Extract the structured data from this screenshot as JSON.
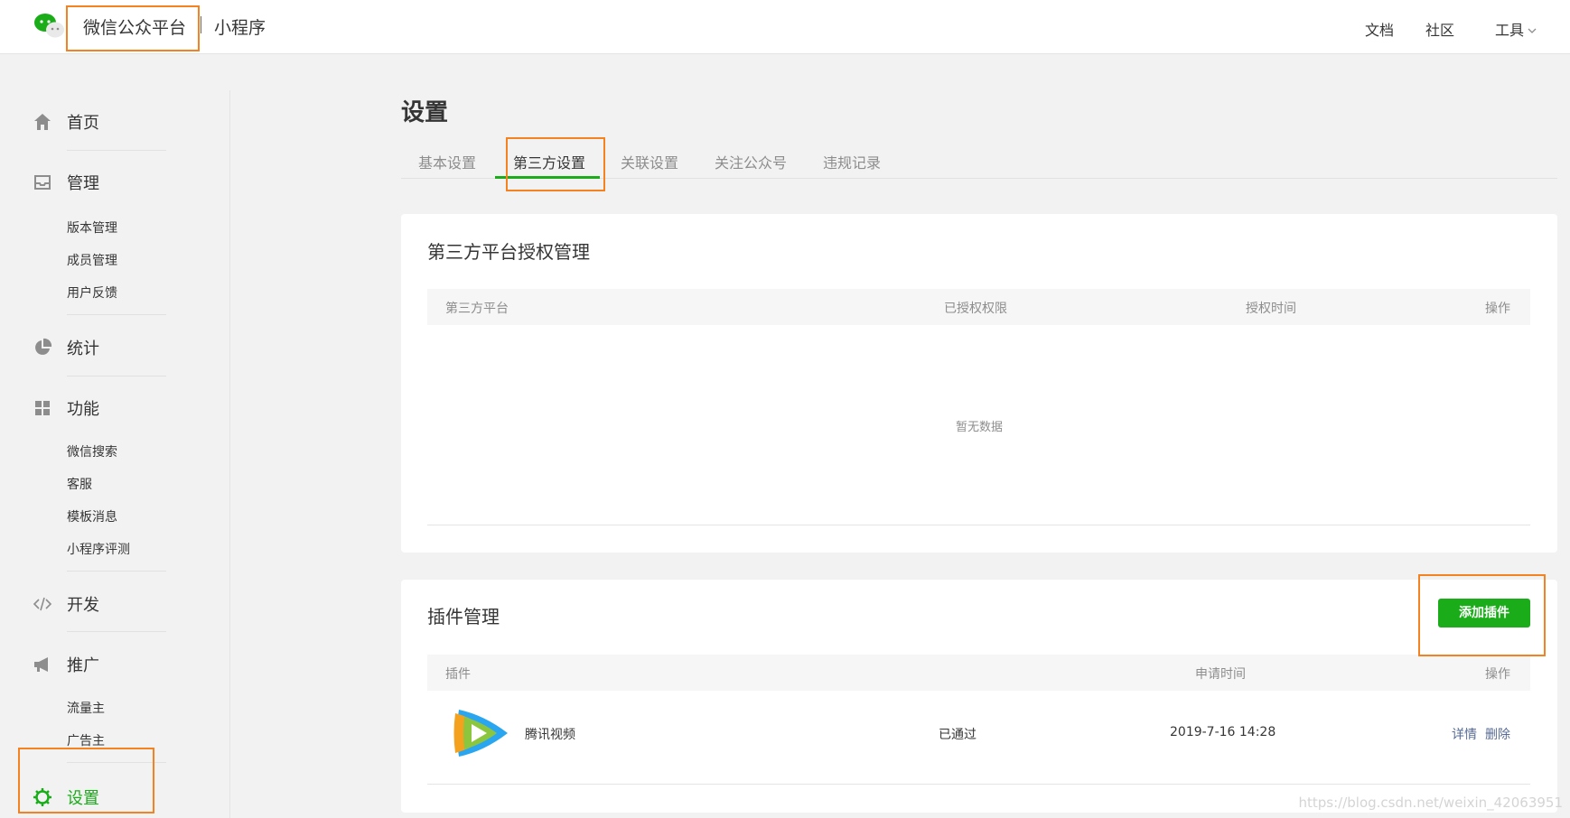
{
  "header": {
    "brand": "微信公众平台",
    "product": "小程序",
    "nav": [
      "文档",
      "社区",
      "工具"
    ]
  },
  "sidebar": {
    "home": "首页",
    "manage": {
      "label": "管理",
      "items": [
        "版本管理",
        "成员管理",
        "用户反馈"
      ]
    },
    "stats": "统计",
    "features": {
      "label": "功能",
      "items": [
        "微信搜索",
        "客服",
        "模板消息",
        "小程序评测"
      ]
    },
    "dev": "开发",
    "promo": {
      "label": "推广",
      "items": [
        "流量主",
        "广告主"
      ]
    },
    "settings": "设置"
  },
  "main": {
    "title": "设置",
    "tabs": [
      "基本设置",
      "第三方设置",
      "关联设置",
      "关注公众号",
      "违规记录"
    ],
    "active_tab": "第三方设置"
  },
  "third_party": {
    "title": "第三方平台授权管理",
    "columns": [
      "第三方平台",
      "已授权权限",
      "授权时间",
      "操作"
    ],
    "empty": "暂无数据"
  },
  "plugins": {
    "title": "插件管理",
    "add_button": "添加插件",
    "columns": [
      "插件",
      "申请时间",
      "操作"
    ],
    "rows": [
      {
        "name": "腾讯视频",
        "status": "已通过",
        "time": "2019-7-16 14:28",
        "actions": [
          "详情",
          "删除"
        ]
      }
    ]
  },
  "watermark": "https://blog.csdn.net/weixin_42063951",
  "colors": {
    "accent": "#1aad19",
    "link": "#576b95",
    "annotation": "#f58220"
  }
}
